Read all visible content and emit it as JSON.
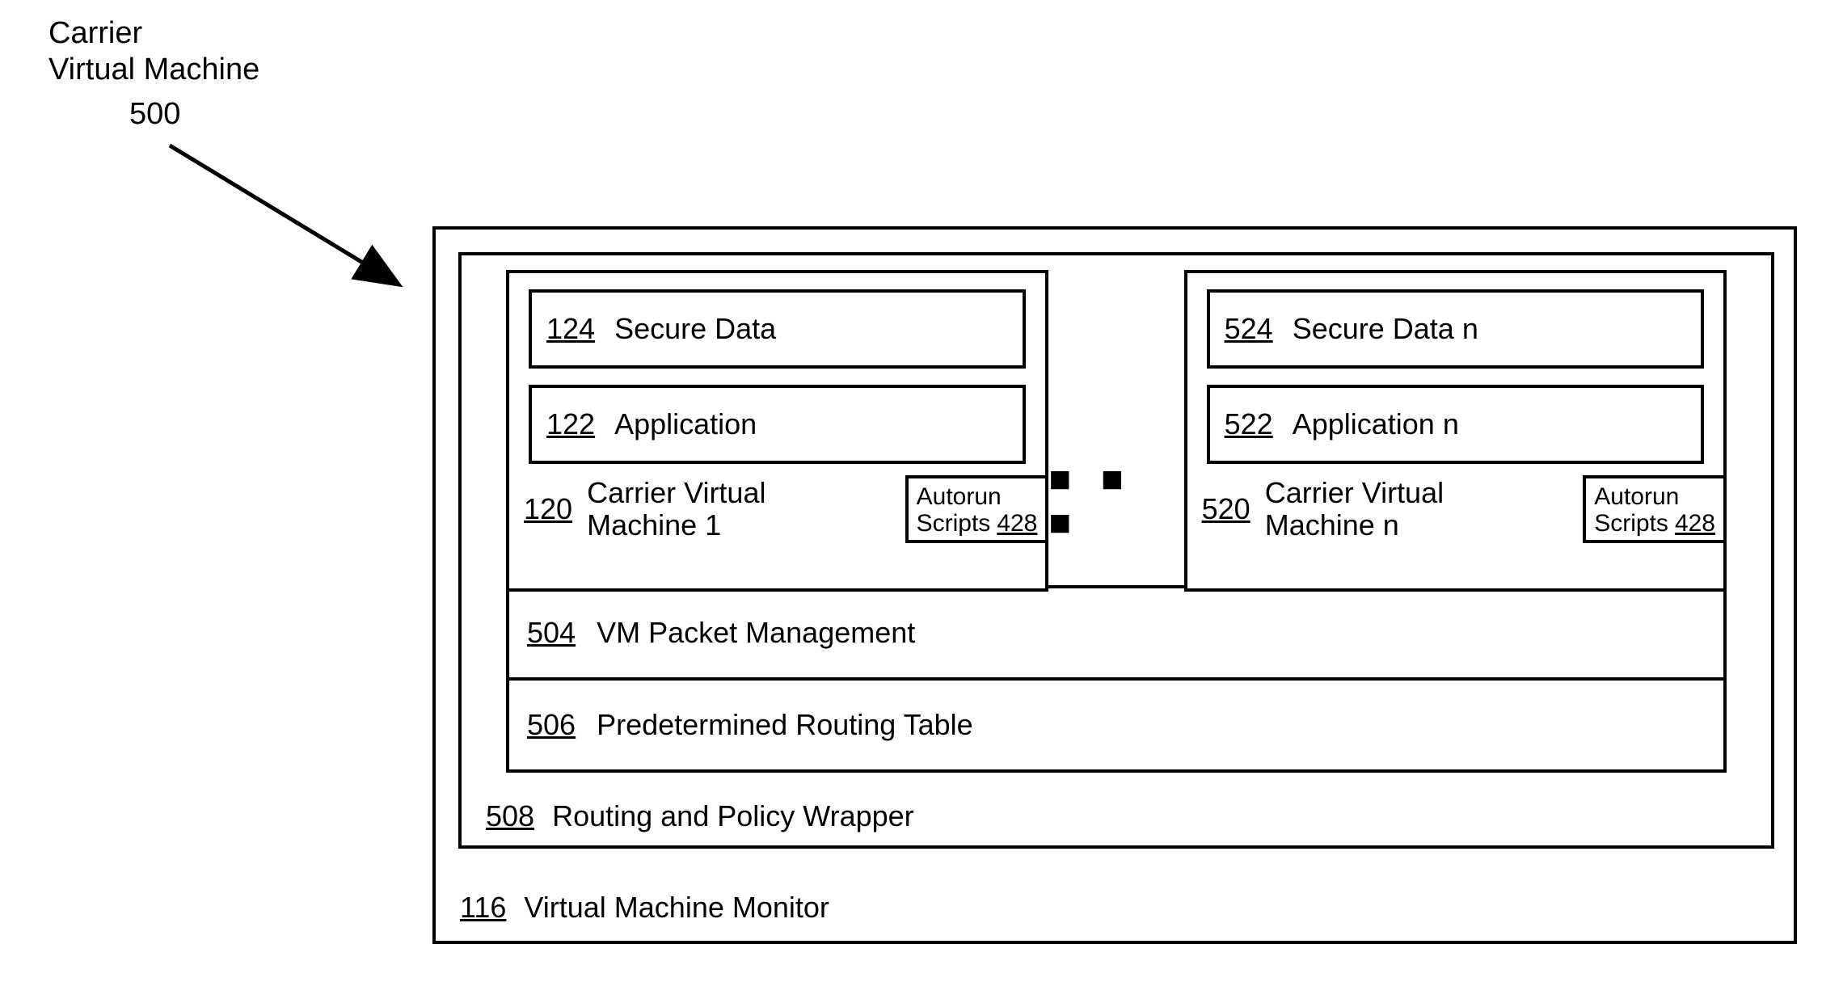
{
  "title": {
    "line1": "Carrier",
    "line2": "Virtual Machine",
    "refnum": "500"
  },
  "ellipsis": "■ ■ ■",
  "vmm": {
    "ref": "116",
    "label": "Virtual Machine Monitor"
  },
  "wrapper": {
    "ref": "508",
    "label": "Routing and Policy Wrapper"
  },
  "packet": {
    "ref": "504",
    "label": "VM Packet Management"
  },
  "routing": {
    "ref": "506",
    "label": "Predetermined Routing Table"
  },
  "vms": [
    {
      "secure": {
        "ref": "124",
        "label": "Secure Data"
      },
      "app": {
        "ref": "122",
        "label": "Application"
      },
      "carrier": {
        "ref": "120",
        "label_l1": "Carrier Virtual",
        "label_l2": "Machine 1"
      },
      "autorun": {
        "label_l1": "Autorun",
        "label_l2": "Scripts",
        "ref": "428"
      }
    },
    {
      "secure": {
        "ref": "524",
        "label": "Secure Data n"
      },
      "app": {
        "ref": "522",
        "label": "Application n"
      },
      "carrier": {
        "ref": "520",
        "label_l1": "Carrier Virtual",
        "label_l2": "Machine n"
      },
      "autorun": {
        "label_l1": "Autorun",
        "label_l2": "Scripts",
        "ref": "428"
      }
    }
  ]
}
